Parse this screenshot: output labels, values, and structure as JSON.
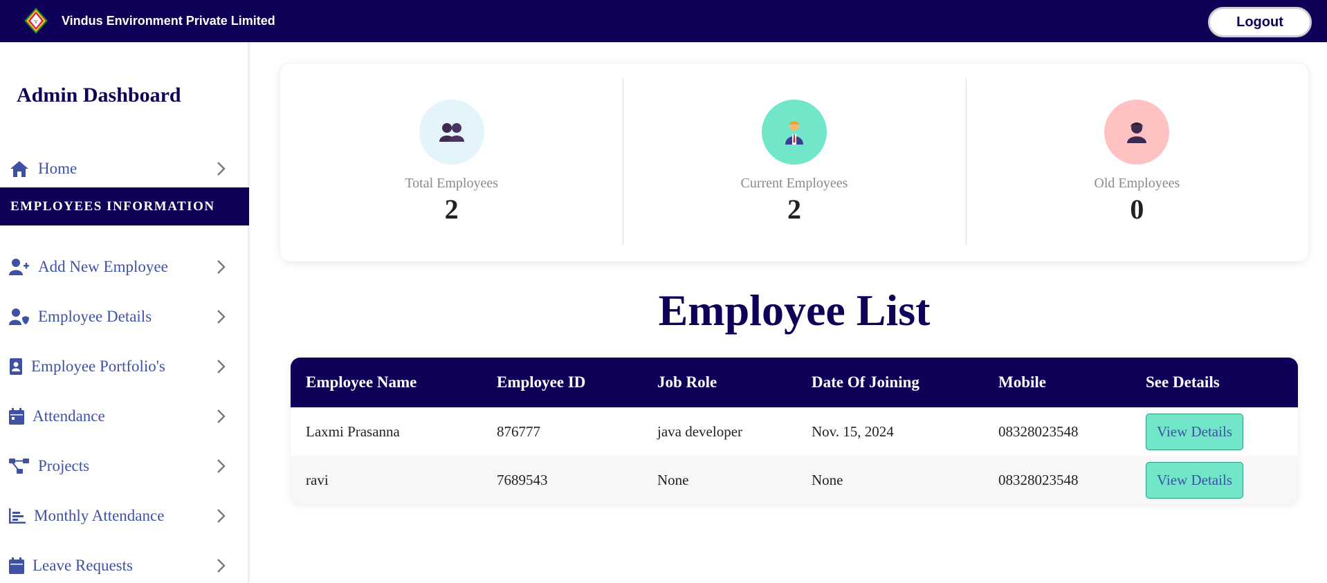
{
  "header": {
    "brand_name": "Vindus Environment Private Limited",
    "logout_label": "Logout",
    "colors": {
      "navy": "#0e0258",
      "accent": "#71e6c9"
    }
  },
  "sidebar": {
    "title": "Admin Dashboard",
    "home": {
      "label": "Home",
      "icon": "home-icon"
    },
    "section_header": "EMPLOYEES INFORMATION",
    "items": [
      {
        "label": "Add New Employee",
        "icon": "user-plus-icon"
      },
      {
        "label": "Employee Details",
        "icon": "user-shield-icon"
      },
      {
        "label": "Employee Portfolio's",
        "icon": "portfolio-icon"
      },
      {
        "label": "Attendance",
        "icon": "calendar-icon"
      },
      {
        "label": "Projects",
        "icon": "project-diagram-icon"
      },
      {
        "label": "Monthly Attendance",
        "icon": "bar-chart-icon"
      },
      {
        "label": "Leave Requests",
        "icon": "calendar-icon"
      }
    ]
  },
  "stats": [
    {
      "label": "Total Employees",
      "value": "2",
      "icon": "users-icon",
      "color": "#e3f5fb"
    },
    {
      "label": "Current Employees",
      "value": "2",
      "icon": "employee-icon",
      "color": "#71e6c9"
    },
    {
      "label": "Old Employees",
      "value": "0",
      "icon": "user-icon",
      "color": "#ffc2c2"
    }
  ],
  "employee_list": {
    "title": "Employee List",
    "columns": [
      "Employee Name",
      "Employee ID",
      "Job Role",
      "Date Of Joining",
      "Mobile",
      "See Details"
    ],
    "rows": [
      {
        "name": "Laxmi Prasanna",
        "id": "876777",
        "role": "java developer",
        "doj": "Nov. 15, 2024",
        "mobile": "08328023548",
        "action": "View Details"
      },
      {
        "name": "ravi",
        "id": "7689543",
        "role": "None",
        "doj": "None",
        "mobile": "08328023548",
        "action": "View Details"
      }
    ]
  }
}
